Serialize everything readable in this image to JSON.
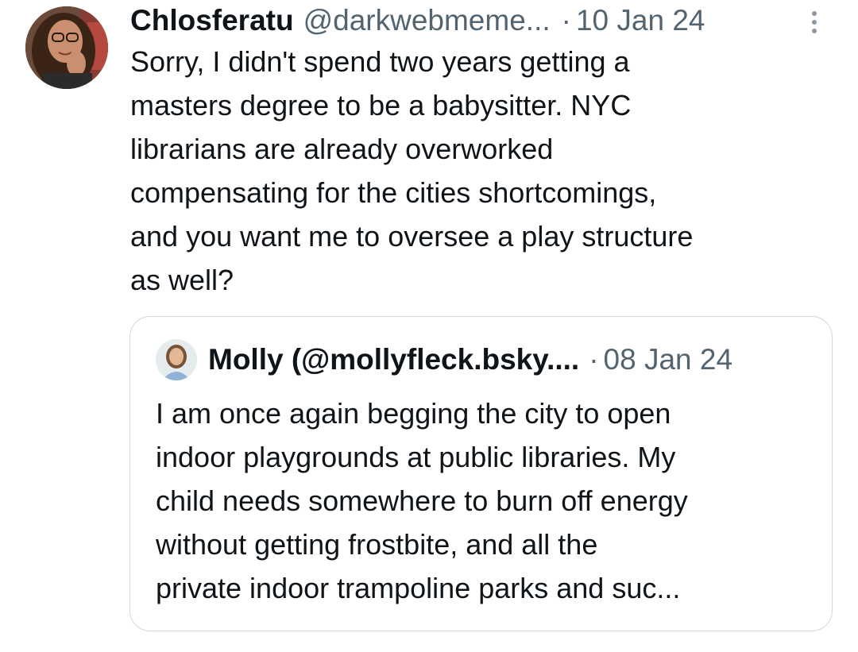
{
  "tweet": {
    "display_name": "Chlosferatu",
    "handle": "@darkwebmeme...",
    "separator": "·",
    "date": "10 Jan 24",
    "text": "Sorry, I didn't spend two years getting a\nmasters degree to be a babysitter. NYC\nlibrarians are already overworked\ncompensating for the cities shortcomings,\nand you want me to oversee a play structure\nas well?",
    "more_icon": "more-vertical-icon"
  },
  "quoted_tweet": {
    "display_name": "Molly (@mollyfleck.bsky....",
    "separator": "·",
    "date": "08 Jan 24",
    "text": "I am once again begging the city to open\nindoor playgrounds at public libraries. My\nchild needs somewhere to burn off energy\nwithout getting frostbite, and all the\nprivate indoor trampoline parks and suc..."
  },
  "colors": {
    "primary_text": "#0f1419",
    "secondary_text": "#536471",
    "border": "#cfd9de",
    "background": "#ffffff"
  }
}
